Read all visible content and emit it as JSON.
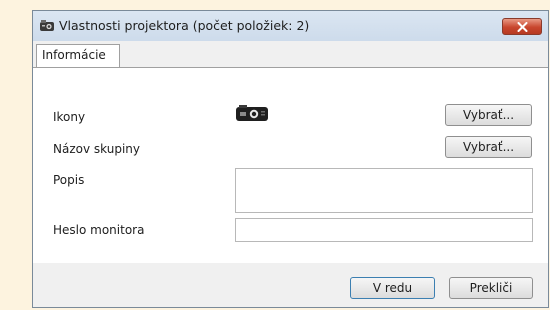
{
  "window": {
    "title": "Vlastnosti projektora (počet položiek: 2)"
  },
  "tabs": [
    {
      "label": "Informácie"
    }
  ],
  "form": {
    "icons_label": "Ikony",
    "icons_button": "Vybrať...",
    "group_name_label": "Názov skupiny",
    "group_name_button": "Vybrať...",
    "description_label": "Popis",
    "description_value": "",
    "monitor_password_label": "Heslo monitora",
    "monitor_password_value": ""
  },
  "footer": {
    "ok_label": "V redu",
    "cancel_label": "Prekliči"
  },
  "icons": {
    "title": "projector-window-icon",
    "close": "close-icon",
    "selected_group_icon": "projector-icon"
  },
  "colors": {
    "close_button": "#c8462e",
    "ok_border": "#3c7fb1",
    "page_background": "#fdf3df"
  }
}
